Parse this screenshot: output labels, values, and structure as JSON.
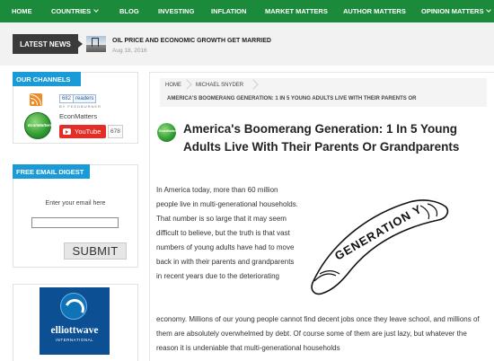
{
  "nav": {
    "items": [
      {
        "label": "HOME",
        "dropdown": false
      },
      {
        "label": "COUNTRIES",
        "dropdown": true
      },
      {
        "label": "BLOG",
        "dropdown": false
      },
      {
        "label": "INVESTING",
        "dropdown": false
      },
      {
        "label": "INFLATION",
        "dropdown": false
      },
      {
        "label": "MARKET MATTERS",
        "dropdown": false
      },
      {
        "label": "AUTHOR MATTERS",
        "dropdown": false
      },
      {
        "label": "OPINION MATTERS",
        "dropdown": true
      }
    ],
    "color": "#1b8a3b"
  },
  "latest_news": {
    "label": "LATEST NEWS",
    "headline": "OIL PRICE AND ECONOMIC GROWTH GET MARRIED",
    "date": "Aug 18, 2016"
  },
  "sidebar": {
    "channels": {
      "heading": "OUR CHANNELS",
      "readers_count": "682",
      "readers_label": "readers",
      "feedburner_text": "BY FEEDBURNER",
      "logo_text": "EconMatters",
      "name": "EconMatters",
      "youtube_label": "YouTube",
      "youtube_count": "678"
    },
    "email_digest": {
      "heading": "FREE EMAIL DIGEST",
      "label": "Enter your email here",
      "input_value": "",
      "submit_label": "SUBMIT"
    },
    "ad": {
      "brand": "elliottwave",
      "sub": "INTERNATIONAL"
    },
    "accent": "#1a9ad6"
  },
  "breadcrumb": {
    "home": "HOME",
    "author": "MICHAEL SNYDER",
    "current": "AMERICA'S BOOMERANG GENERATION: 1 IN 5 YOUNG ADULTS LIVE WITH THEIR PARENTS OR"
  },
  "article": {
    "title": "America's Boomerang Generation: 1 In 5 Young Adults Live With Their Parents Or Grandparents",
    "para1": "In America today, more than 60 million people live in multi-generational households.  That number is so large that it may seem difficult to believe, but the truth is that vast numbers of young adults have had to move back in with their parents and grandparents in recent years due to the deteriorating",
    "para2": "economy.  Millions of our young people cannot find decent jobs once they leave school, and millions of them are absolutely overwhelmed by debt.  Of course some of them are just lazy, but whatever the reason it is undeniable that multi-generational households",
    "image_text": "GENERATION Y",
    "icon_text": "EconMatters"
  }
}
